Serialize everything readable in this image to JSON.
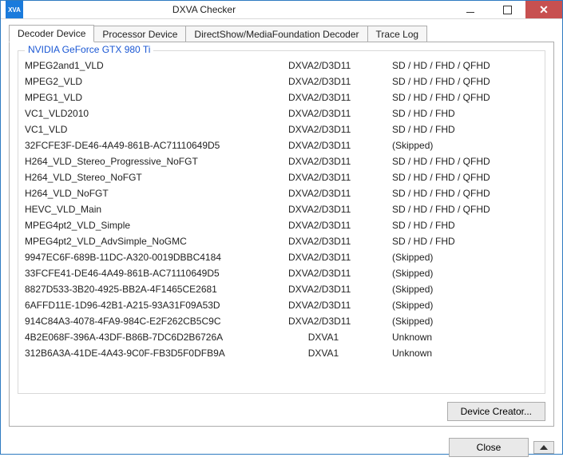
{
  "window": {
    "icon_text": "XVA",
    "title": "DXVA Checker"
  },
  "tabs": [
    {
      "label": "Decoder Device",
      "active": true
    },
    {
      "label": "Processor Device",
      "active": false
    },
    {
      "label": "DirectShow/MediaFoundation Decoder",
      "active": false
    },
    {
      "label": "Trace Log",
      "active": false
    }
  ],
  "groupbox_title": "NVIDIA GeForce GTX 980 Ti",
  "rows": [
    {
      "name": "MPEG2and1_VLD",
      "api": "DXVA2/D3D11",
      "res": "SD / HD / FHD / QFHD"
    },
    {
      "name": "MPEG2_VLD",
      "api": "DXVA2/D3D11",
      "res": "SD / HD / FHD / QFHD"
    },
    {
      "name": "MPEG1_VLD",
      "api": "DXVA2/D3D11",
      "res": "SD / HD / FHD / QFHD"
    },
    {
      "name": "VC1_VLD2010",
      "api": "DXVA2/D3D11",
      "res": "SD / HD / FHD"
    },
    {
      "name": "VC1_VLD",
      "api": "DXVA2/D3D11",
      "res": "SD / HD / FHD"
    },
    {
      "name": "32FCFE3F-DE46-4A49-861B-AC71110649D5",
      "api": "DXVA2/D3D11",
      "res": "(Skipped)"
    },
    {
      "name": "H264_VLD_Stereo_Progressive_NoFGT",
      "api": "DXVA2/D3D11",
      "res": "SD / HD / FHD / QFHD"
    },
    {
      "name": "H264_VLD_Stereo_NoFGT",
      "api": "DXVA2/D3D11",
      "res": "SD / HD / FHD / QFHD"
    },
    {
      "name": "H264_VLD_NoFGT",
      "api": "DXVA2/D3D11",
      "res": "SD / HD / FHD / QFHD"
    },
    {
      "name": "HEVC_VLD_Main",
      "api": "DXVA2/D3D11",
      "res": "SD / HD / FHD / QFHD"
    },
    {
      "name": "MPEG4pt2_VLD_Simple",
      "api": "DXVA2/D3D11",
      "res": "SD / HD / FHD"
    },
    {
      "name": "MPEG4pt2_VLD_AdvSimple_NoGMC",
      "api": "DXVA2/D3D11",
      "res": "SD / HD / FHD"
    },
    {
      "name": "9947EC6F-689B-11DC-A320-0019DBBC4184",
      "api": "DXVA2/D3D11",
      "res": "(Skipped)"
    },
    {
      "name": "33FCFE41-DE46-4A49-861B-AC71110649D5",
      "api": "DXVA2/D3D11",
      "res": "(Skipped)"
    },
    {
      "name": "8827D533-3B20-4925-BB2A-4F1465CE2681",
      "api": "DXVA2/D3D11",
      "res": "(Skipped)"
    },
    {
      "name": "6AFFD11E-1D96-42B1-A215-93A31F09A53D",
      "api": "DXVA2/D3D11",
      "res": "(Skipped)"
    },
    {
      "name": "914C84A3-4078-4FA9-984C-E2F262CB5C9C",
      "api": "DXVA2/D3D11",
      "res": "(Skipped)"
    },
    {
      "name": "4B2E068F-396A-43DF-B86B-7DC6D2B6726A",
      "api": "DXVA1",
      "res": "Unknown"
    },
    {
      "name": "312B6A3A-41DE-4A43-9C0F-FB3D5F0DFB9A",
      "api": "DXVA1",
      "res": "Unknown"
    }
  ],
  "buttons": {
    "device_creator": "Device Creator...",
    "close": "Close"
  }
}
